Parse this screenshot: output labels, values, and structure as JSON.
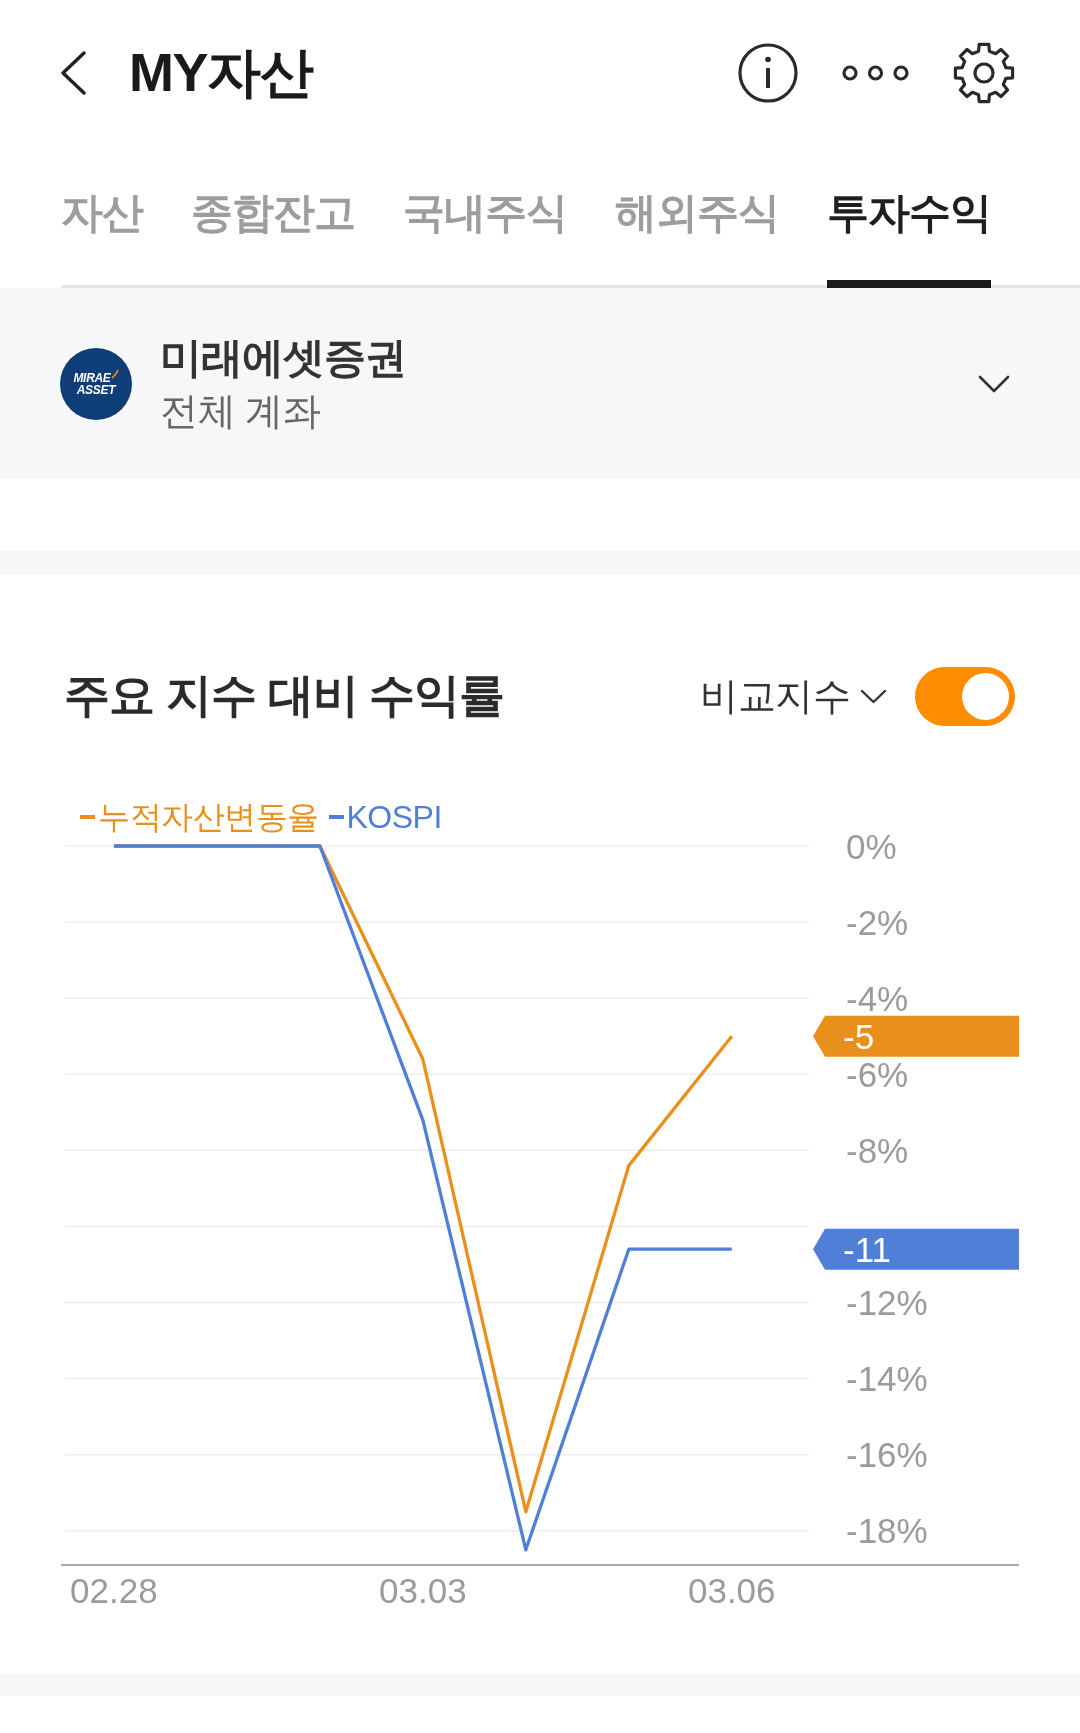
{
  "header": {
    "title": "MY자산"
  },
  "tabs": [
    {
      "label": "자산",
      "selected": false
    },
    {
      "label": "종합잔고",
      "selected": false
    },
    {
      "label": "국내주식",
      "selected": false
    },
    {
      "label": "해외주식",
      "selected": false
    },
    {
      "label": "투자수익",
      "selected": true
    }
  ],
  "account": {
    "logo_text": [
      "MIRAE",
      "ASSET"
    ],
    "name": "미래에셋증권",
    "subtitle": "전체 계좌"
  },
  "chart_card": {
    "title": "주요 지수 대비 수익률",
    "index_select": {
      "label": "비교지수"
    },
    "toggle": {
      "on": true
    },
    "chart_data": {
      "type": "line",
      "categories": [
        "02.28",
        null,
        null,
        "03.03",
        null,
        null,
        "03.06"
      ],
      "ylim": [
        -18.9,
        0
      ],
      "grid": true,
      "legend": "top-left",
      "yticks": [
        {
          "value": 0,
          "label": "0%"
        },
        {
          "value": -2,
          "label": "-2%"
        },
        {
          "value": -4,
          "label": "-4%"
        },
        {
          "value": -6,
          "label": "-6%"
        },
        {
          "value": -8,
          "label": "-8%"
        },
        {
          "value": -12,
          "label": "-12%"
        },
        {
          "value": -14,
          "label": "-14%"
        },
        {
          "value": -16,
          "label": "-16%"
        },
        {
          "value": -18,
          "label": "-18%"
        }
      ],
      "series": [
        {
          "name": "누적자산변동율",
          "color": "#e9901c",
          "values": [
            0,
            0,
            0,
            -5.6,
            -17.5,
            -8.4,
            -5
          ]
        },
        {
          "name": "KOSPI",
          "color": "#4f7fd7",
          "values": [
            0,
            0,
            0,
            -7.2,
            -18.5,
            -10.6,
            -10.6
          ]
        }
      ],
      "annotations": [
        "-5",
        "-11"
      ]
    }
  }
}
